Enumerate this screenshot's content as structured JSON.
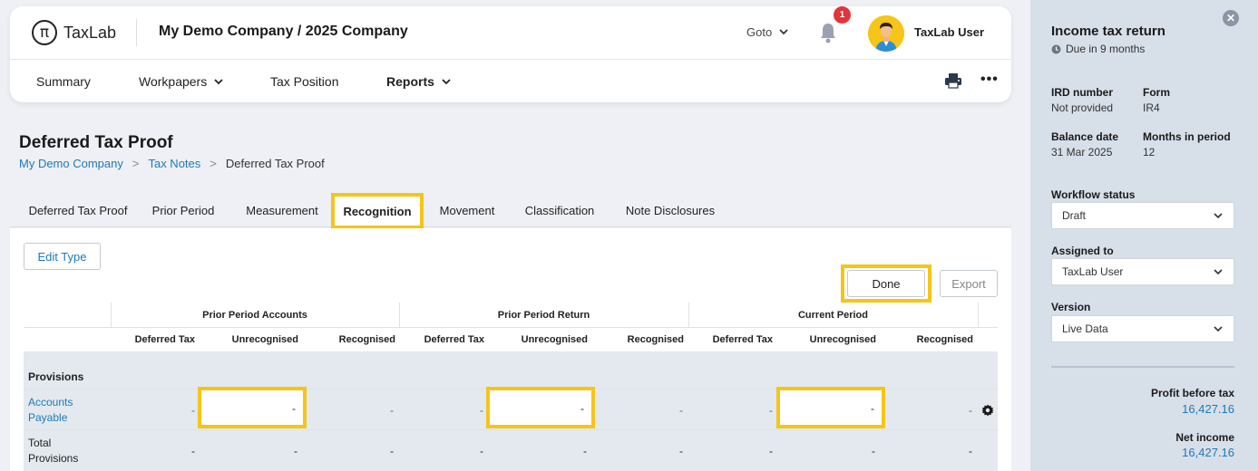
{
  "header": {
    "logo_text": "TaxLab",
    "logo_glyph": "π",
    "company_title": "My Demo Company / 2025 Company",
    "goto_label": "Goto",
    "notification_count": "1",
    "user_name": "TaxLab User"
  },
  "nav": {
    "items": [
      {
        "label": "Summary"
      },
      {
        "label": "Workpapers"
      },
      {
        "label": "Tax Position"
      },
      {
        "label": "Reports"
      }
    ],
    "more_label": "•••"
  },
  "page": {
    "title": "Deferred Tax Proof",
    "breadcrumb": [
      "My Demo Company",
      "Tax Notes",
      "Deferred Tax Proof"
    ],
    "breadcrumb_sep": ">"
  },
  "tabs": [
    {
      "label": "Deferred Tax Proof"
    },
    {
      "label": "Prior Period"
    },
    {
      "label": "Measurement"
    },
    {
      "label": "Recognition"
    },
    {
      "label": "Movement"
    },
    {
      "label": "Classification"
    },
    {
      "label": "Note Disclosures"
    }
  ],
  "active_tab": "Recognition",
  "toolbar": {
    "edit_type": "Edit Type",
    "done": "Done",
    "export": "Export"
  },
  "table": {
    "groups": [
      "Prior Period Accounts",
      "Prior Period Return",
      "Current Period"
    ],
    "columns": [
      "Deferred Tax",
      "Unrecognised",
      "Recognised",
      "Deferred Tax",
      "Unrecognised",
      "Recognised",
      "Deferred Tax",
      "Unrecognised",
      "Recognised"
    ],
    "section": "Provisions",
    "rows": [
      {
        "label": "Accounts Payable",
        "values": [
          "-",
          "-",
          "-",
          "-",
          "-",
          "-",
          "-",
          "-",
          "-"
        ]
      },
      {
        "label": "Total Provisions",
        "values": [
          "-",
          "-",
          "-",
          "-",
          "-",
          "-",
          "-",
          "-",
          "-"
        ]
      }
    ]
  },
  "sidebar": {
    "close_label": "✕",
    "title": "Income tax return",
    "due": "Due in 9 months",
    "ird_number_label": "IRD number",
    "ird_number_value": "Not provided",
    "form_label": "Form",
    "form_value": "IR4",
    "balance_date_label": "Balance date",
    "balance_date_value": "31 Mar 2025",
    "months_label": "Months in period",
    "months_value": "12",
    "workflow_label": "Workflow status",
    "workflow_value": "Draft",
    "assigned_label": "Assigned to",
    "assigned_value": "TaxLab User",
    "version_label": "Version",
    "version_value": "Live Data",
    "profit_label": "Profit before tax",
    "profit_value": "16,427.16",
    "net_income_label": "Net income",
    "net_income_value": "16,427.16"
  },
  "colors": {
    "highlight": "#f5c518",
    "link": "#1f7ab8",
    "sidebar_bg": "#d7dfe9",
    "badge": "#e2343a"
  }
}
